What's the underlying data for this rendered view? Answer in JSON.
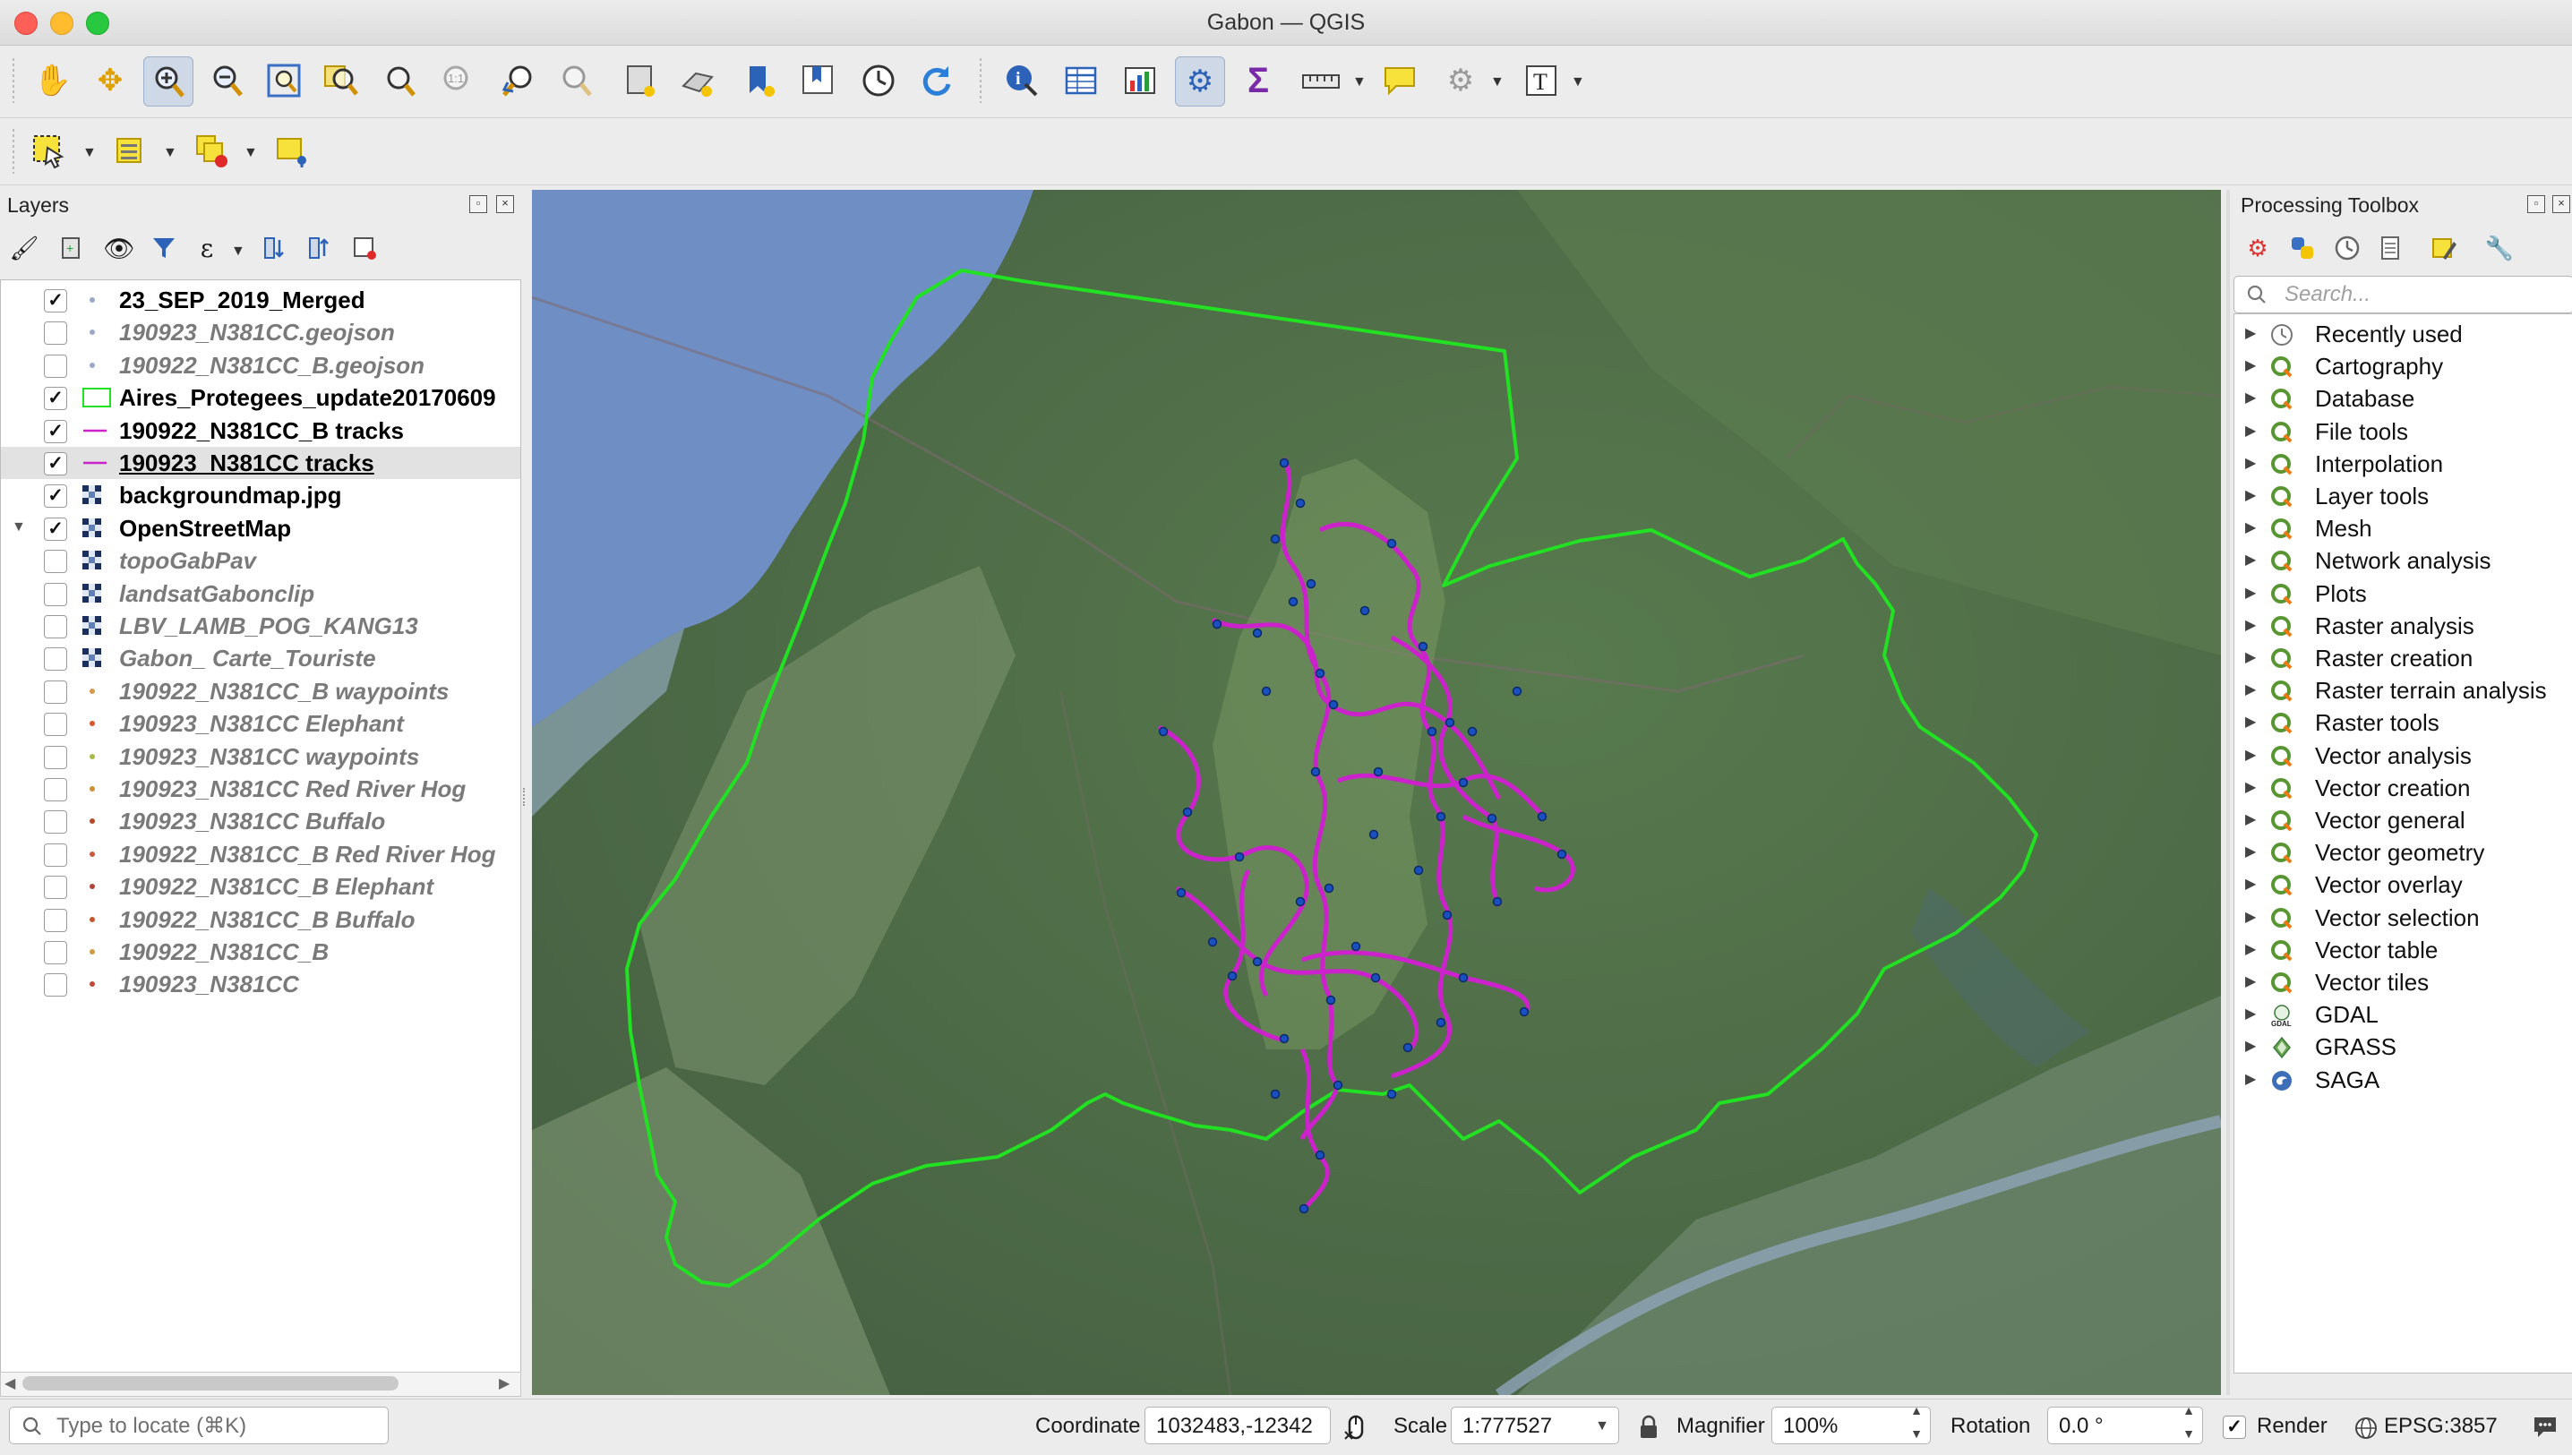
{
  "window": {
    "title": "Gabon — QGIS"
  },
  "toolbar1": {
    "buttons": [
      "pan-map",
      "pan-to-selection",
      "zoom-in",
      "zoom-out",
      "zoom-full",
      "zoom-to-selection",
      "zoom-to-layer",
      "zoom-native",
      "zoom-last",
      "zoom-next",
      "new-map-view",
      "new-3d-view",
      "new-bookmark",
      "show-bookmarks",
      "temporal-controller",
      "refresh",
      "identify",
      "attribute-table",
      "statistical-summary",
      "processing-toolbox",
      "field-calculator",
      "measure",
      "map-tips",
      "settings-gear",
      "text-annotation"
    ]
  },
  "toolbar2": {
    "buttons": [
      "select-features",
      "open-attribute-table-selection",
      "deselect-all",
      "annotation-marker"
    ]
  },
  "layers_panel": {
    "title": "Layers",
    "layers": [
      {
        "name": "23_SEP_2019_Merged",
        "checked": true
      },
      {
        "name": "190923_N381CC.geojson",
        "checked": false
      },
      {
        "name": "190922_N381CC_B.geojson",
        "checked": false
      },
      {
        "name": "Aires_Protegees_update20170609",
        "checked": true
      },
      {
        "name": "190922_N381CC_B tracks",
        "checked": true
      },
      {
        "name": "190923_N381CC tracks",
        "checked": true
      },
      {
        "name": "backgroundmap.jpg",
        "checked": true
      },
      {
        "name": "OpenStreetMap",
        "checked": true
      },
      {
        "name": "topoGabPav",
        "checked": false
      },
      {
        "name": "landsatGabonclip",
        "checked": false
      },
      {
        "name": "LBV_LAMB_POG_KANG13",
        "checked": false
      },
      {
        "name": "Gabon_ Carte_Touriste",
        "checked": false
      },
      {
        "name": "190922_N381CC_B waypoints",
        "checked": false
      },
      {
        "name": "190923_N381CC Elephant",
        "checked": false
      },
      {
        "name": "190923_N381CC waypoints",
        "checked": false
      },
      {
        "name": "190923_N381CC Red River Hog",
        "checked": false
      },
      {
        "name": "190923_N381CC Buffalo",
        "checked": false
      },
      {
        "name": "190922_N381CC_B Red River Hog",
        "checked": false
      },
      {
        "name": "190922_N381CC_B Elephant",
        "checked": false
      },
      {
        "name": "190922_N381CC_B Buffalo",
        "checked": false
      },
      {
        "name": "190922_N381CC_B",
        "checked": false
      },
      {
        "name": "190923_N381CC",
        "checked": false
      }
    ]
  },
  "toolbox": {
    "title": "Processing Toolbox",
    "search_placeholder": "Search...",
    "items": [
      "Recently used",
      "Cartography",
      "Database",
      "File tools",
      "Interpolation",
      "Layer tools",
      "Mesh",
      "Network analysis",
      "Plots",
      "Raster analysis",
      "Raster creation",
      "Raster terrain analysis",
      "Raster tools",
      "Vector analysis",
      "Vector creation",
      "Vector general",
      "Vector geometry",
      "Vector overlay",
      "Vector selection",
      "Vector table",
      "Vector tiles",
      "GDAL",
      "GRASS",
      "SAGA"
    ]
  },
  "status": {
    "locate_placeholder": "Type to locate (⌘K)",
    "coordinate_label": "Coordinate",
    "coordinate_value": "1032483,-12342",
    "scale_label": "Scale",
    "scale_value": "1:777527",
    "magnifier_label": "Magnifier",
    "magnifier_value": "100%",
    "rotation_label": "Rotation",
    "rotation_value": "0.0 °",
    "render_label": "Render",
    "crs": "EPSG:3857"
  },
  "colors": {
    "boundary": "#22e022",
    "tracks": "#cc22cc",
    "waypoints": "#1a4fbf",
    "ocean": "#6f8fc4",
    "forest": "#4f6e49"
  }
}
